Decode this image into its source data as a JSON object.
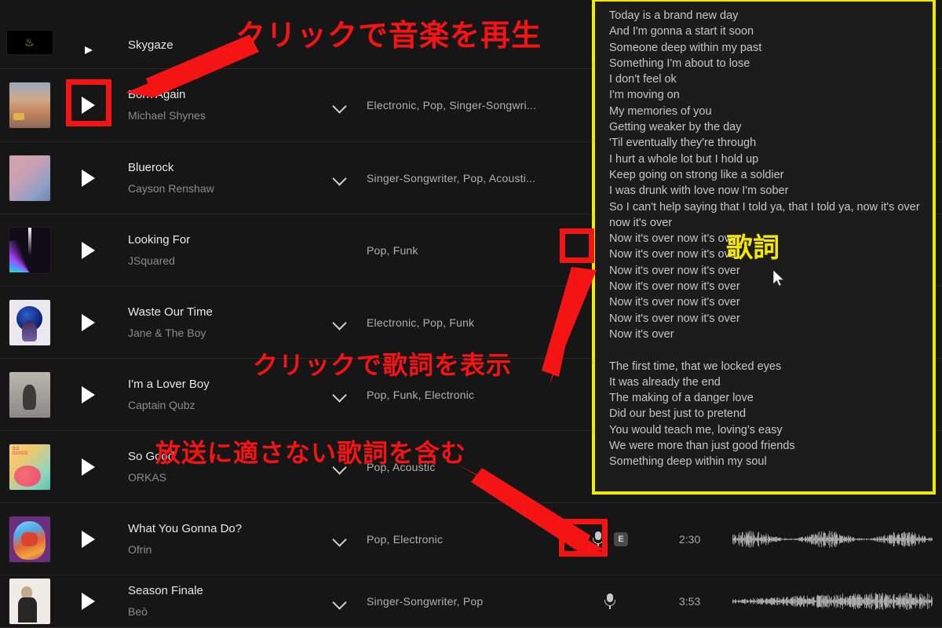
{
  "app": {
    "theme_bg": "#161616",
    "accent_red": "#f41414",
    "accent_yellow": "#f3e600"
  },
  "tracks": [
    {
      "title": "",
      "artist": "",
      "album_art": "art-skygaze",
      "genres": "",
      "album_name": "Skygaze",
      "duration": "",
      "has_mic": false,
      "explicit": false,
      "partial": true
    },
    {
      "title": "Born Again",
      "artist": "Michael Shynes",
      "album_art": "art-born",
      "genres": "Electronic,  Pop,  Singer-Songwri...",
      "duration": "",
      "has_mic": true,
      "explicit": false,
      "partial": false
    },
    {
      "title": "Bluerock",
      "artist": "Cayson Renshaw",
      "album_art": "art-blue",
      "genres": "Singer-Songwriter,  Pop,  Acousti...",
      "duration": "",
      "has_mic": true,
      "explicit": false,
      "partial": false
    },
    {
      "title": "Looking For",
      "artist": "JSquared",
      "album_art": "art-look",
      "genres": "Pop,  Funk",
      "duration": "",
      "has_mic": true,
      "explicit": false,
      "partial": false,
      "mic_highlighted": true,
      "no_chevron": true
    },
    {
      "title": "Waste Our Time",
      "artist": "Jane & The Boy",
      "album_art": "art-waste",
      "genres": "Electronic,  Pop,  Funk",
      "duration": "",
      "has_mic": true,
      "explicit": false,
      "partial": false
    },
    {
      "title": "I'm a Lover Boy",
      "artist": "Captain Qubz",
      "album_art": "art-lover",
      "genres": "Pop,  Funk,  Electronic",
      "duration": "",
      "has_mic": true,
      "explicit": false,
      "partial": false
    },
    {
      "title": "So Good",
      "artist": "ORKAS",
      "album_art": "art-sogood",
      "genres": "Pop,  Acoustic",
      "duration": "",
      "has_mic": true,
      "explicit": false,
      "partial": false
    },
    {
      "title": "What You Gonna Do?",
      "artist": "Ofrin",
      "album_art": "art-what",
      "genres": "Pop,  Electronic",
      "duration": "2:30",
      "has_mic": true,
      "explicit": true,
      "explicit_label": "E",
      "partial": false
    },
    {
      "title": "Season Finale",
      "artist": "Beò",
      "album_art": "art-season",
      "genres": "Singer-Songwriter,  Pop",
      "duration": "3:53",
      "has_mic": true,
      "explicit": false,
      "partial": false
    }
  ],
  "lyrics_panel": {
    "title_badge": "歌詞",
    "lines": [
      "Today is a brand new day",
      "And I'm gonna a start it soon",
      "Someone deep within my past",
      "Something I'm about to lose",
      "I don't feel ok",
      "I'm moving on",
      "My memories of you",
      "Getting weaker by the day",
      "'Til eventually they're through",
      "I hurt a whole lot but I hold up",
      "Keep going on strong like a soldier",
      "I was drunk with love now I'm sober",
      "So I can't help saying that I told ya, that I told ya, now it's over",
      "now it's over",
      "Now it's over now it's over",
      "Now it's over now it's over",
      "Now it's over now it's over",
      "Now it's over now it's over",
      "Now it's over now it's over",
      "Now it's over now it's over",
      "Now it's over",
      "",
      "The first time, that we locked eyes",
      "It was already the end",
      "The making of a danger love",
      "Did our best just to pretend",
      "You would teach me, loving's easy",
      "We were more than just good friends",
      "Something deep within my soul"
    ]
  },
  "annotations": {
    "play": "クリックで音楽を再生",
    "lyrics": "クリックで歌詞を表示",
    "explicit": "放送に適さない歌詞を含む"
  },
  "icons": {
    "play": "play-icon",
    "microphone": "microphone-icon",
    "chevron_down": "chevron-down-icon",
    "explicit_badge": "explicit-badge-icon",
    "cursor": "mouse-cursor-icon"
  }
}
